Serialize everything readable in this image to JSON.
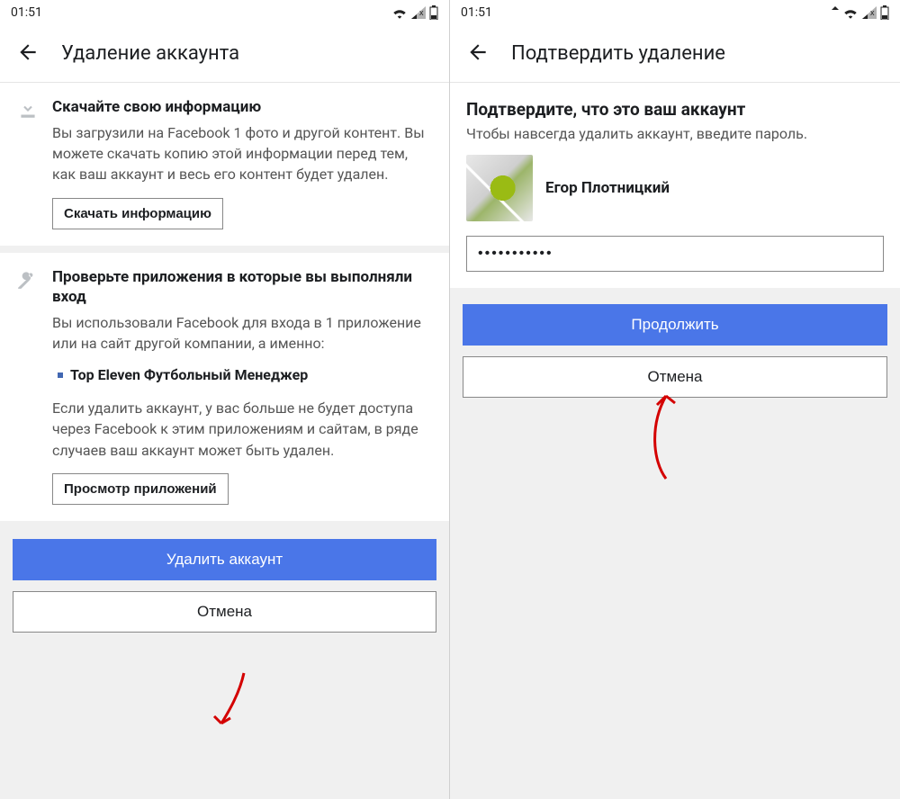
{
  "left": {
    "status_time": "01:51",
    "header_title": "Удаление аккаунта",
    "section1": {
      "title": "Скачайте свою информацию",
      "text": "Вы загрузили на Facebook 1 фото и другой контент. Вы можете скачать копию этой информации перед тем, как ваш аккаунт и весь его контент будет удален.",
      "button": "Скачать информацию"
    },
    "section2": {
      "title": "Проверьте приложения в которые вы выполняли вход",
      "text1": "Вы использовали Facebook для входа в 1 приложение или на сайт другой компании, а именно:",
      "app": "Top Eleven Футбольный Менеджер",
      "text2": "Если удалить аккаунт, у вас больше не будет доступа через Facebook к этим приложениям и сайтам, в ряде случаев ваш аккаунт может быть удален.",
      "button": "Просмотр приложений"
    },
    "primary_button": "Удалить аккаунт",
    "cancel_button": "Отмена"
  },
  "right": {
    "status_time": "01:51",
    "header_title": "Подтвердить удаление",
    "confirm_title": "Подтвердите, что это ваш аккаунт",
    "confirm_sub": "Чтобы навсегда удалить аккаунт, введите пароль.",
    "profile_name": "Егор Плотницкий",
    "password_value": "•••••••••••",
    "primary_button": "Продолжить",
    "cancel_button": "Отмена"
  }
}
